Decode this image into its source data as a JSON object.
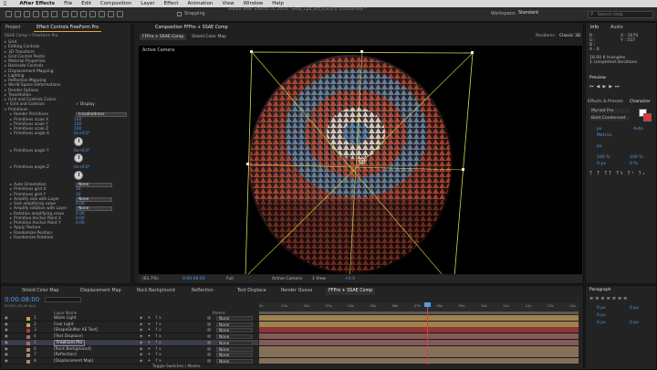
{
  "menubar": {
    "app": "After Effects",
    "items": [
      "File",
      "Edit",
      "Composition",
      "Layer",
      "Effect",
      "Animation",
      "View",
      "Window",
      "Help"
    ],
    "doc_title": "Adobe After Effects CC 2014 - Final_Cpz_Art_(CS5).fr (converted) *"
  },
  "toolbar": {
    "snapping": "Snapping",
    "workspace_label": "Workspace:",
    "workspace_value": "Standard",
    "search_placeholder": "Search Help"
  },
  "left_panel": {
    "tabs": [
      "Project",
      "Effect Controls FreeForm Pro"
    ],
    "header": "SSAE Comp • FreeForm Pro",
    "rows": [
      {
        "t": "Grid"
      },
      {
        "t": "Editing Controls"
      },
      {
        "t": "3D Transform"
      },
      {
        "t": "Grid Control Points"
      },
      {
        "t": "Material Properties"
      },
      {
        "t": "Backside Controls"
      },
      {
        "t": "Displacement Mapping"
      },
      {
        "t": "Lighting"
      },
      {
        "t": "Reflection Mapping"
      },
      {
        "t": "World Space Deformations"
      },
      {
        "t": "Render Options"
      },
      {
        "t": "Tessellation"
      },
      {
        "t": "Grid and Controls Colors"
      }
    ],
    "grid_controls": "Grid and Controls",
    "display": "Display",
    "primitives": "Primitives",
    "render_primitives": "Render Primitives",
    "render_primitives_value": "Icosahedrons",
    "prim_rows": [
      {
        "t": "Primitives scale X",
        "v": "100"
      },
      {
        "t": "Primitives scale Y",
        "v": "100"
      },
      {
        "t": "Primitives scale Z",
        "v": "100"
      },
      {
        "t": "Primitives angle X",
        "v": "0x+0.0°"
      },
      {
        "t": "Primitives angle Y",
        "v": "0x+0.0°"
      },
      {
        "t": "Primitives angle Z",
        "v": "0x+0.0°"
      }
    ],
    "lower_rows": [
      {
        "t": "Auto Orientation",
        "v": "None",
        "dd": true
      },
      {
        "t": "Primitives grid X",
        "v": "20"
      },
      {
        "t": "Primitives grid Y",
        "v": "20"
      },
      {
        "t": "Amplify size with Layer",
        "v": "None",
        "dd": true
      },
      {
        "t": "Size amplifying value",
        "v": "0.00"
      },
      {
        "t": "Amplify rotation with Layer",
        "v": "None",
        "dd": true
      },
      {
        "t": "Rotation amplifying value",
        "v": "0.00"
      },
      {
        "t": "Primitive Anchor Point X",
        "v": "0.00"
      },
      {
        "t": "Primitive Anchor Point Y",
        "v": "0.00"
      },
      {
        "t": "Apply Texture",
        "v": ""
      },
      {
        "t": "Randomize Position",
        "v": ""
      },
      {
        "t": "Randomize Rotation",
        "v": ""
      }
    ]
  },
  "composition": {
    "tab": "Composition FFPro + SSAE Comp",
    "sub_tabs": [
      "FFPro + SSAE Comp",
      "Shield Color Map"
    ],
    "renderer_label": "Renderer:",
    "renderer_value": "Classic 3D",
    "camera_label": "Active Camera",
    "footer": {
      "zoom": "(61.7%)",
      "time": "0:00:08:00",
      "quality": "Full",
      "camera": "Active Camera",
      "views": "1 View",
      "offset": "+0.0"
    }
  },
  "right_panel": {
    "info_tabs": [
      "Info",
      "Audio"
    ],
    "info_lines": [
      "R :",
      "G :",
      "B :",
      "A : 0",
      "X : 1070",
      "Y : 557"
    ],
    "info_status": [
      "18.00 K triangles",
      "1 completed iterations"
    ],
    "preview": "Preview",
    "effects_tab": "Effects & Presets",
    "character_tab": "Character",
    "font": "Myriad Pro",
    "style": "Bold Condensed",
    "auto": "Auto",
    "metrics": "Metrics",
    "px": "px",
    "pct1": "100 %",
    "pct2": "100 %",
    "zero1": "0 px",
    "zero2": "0 %",
    "paragraph": "Paragraph",
    "para_vals": [
      "0 px",
      "0 px",
      "0 px",
      "0 px",
      "0 px"
    ]
  },
  "timeline": {
    "tabs": [
      "Shield Color Map",
      "Displacement Map",
      "Rock Background",
      "Reflection",
      "Text Displace",
      "Render Queue",
      "FFPro + SSAE Comp"
    ],
    "timecode": "0:00:08:00",
    "fps": "00192 (24.00 fps)",
    "col_layer": "Layer Name",
    "col_parent": "Parent",
    "ruler": [
      "0s",
      "01s",
      "02s",
      "03s",
      "04s",
      "05s",
      "06s",
      "07s",
      "08s",
      "09s",
      "10s",
      "11s",
      "12s",
      "13s",
      "14s"
    ],
    "layers": [
      {
        "n": "1",
        "name": "Warm Light",
        "parent": "None",
        "color": "#c9a25a"
      },
      {
        "n": "2",
        "name": "Cool Light",
        "parent": "None",
        "color": "#c9a25a"
      },
      {
        "n": "3",
        "name": "[ShapeShifter AE Text]",
        "parent": "None",
        "color": "#b33b3b"
      },
      {
        "n": "4",
        "name": "[Text Displace]",
        "parent": "None",
        "color": "#a86b6b"
      },
      {
        "n": "5",
        "name": "FreeForm Pro",
        "parent": "None",
        "color": "#a86b6b"
      },
      {
        "n": "6",
        "name": "[Rock Background]",
        "parent": "None",
        "color": "#a68c6b"
      },
      {
        "n": "7",
        "name": "[Reflection]",
        "parent": "None",
        "color": "#a68c6b"
      },
      {
        "n": "8",
        "name": "[Displacement Map]",
        "parent": "None",
        "color": "#a68c6b"
      }
    ],
    "toggle": "Toggle Switches / Modes"
  }
}
